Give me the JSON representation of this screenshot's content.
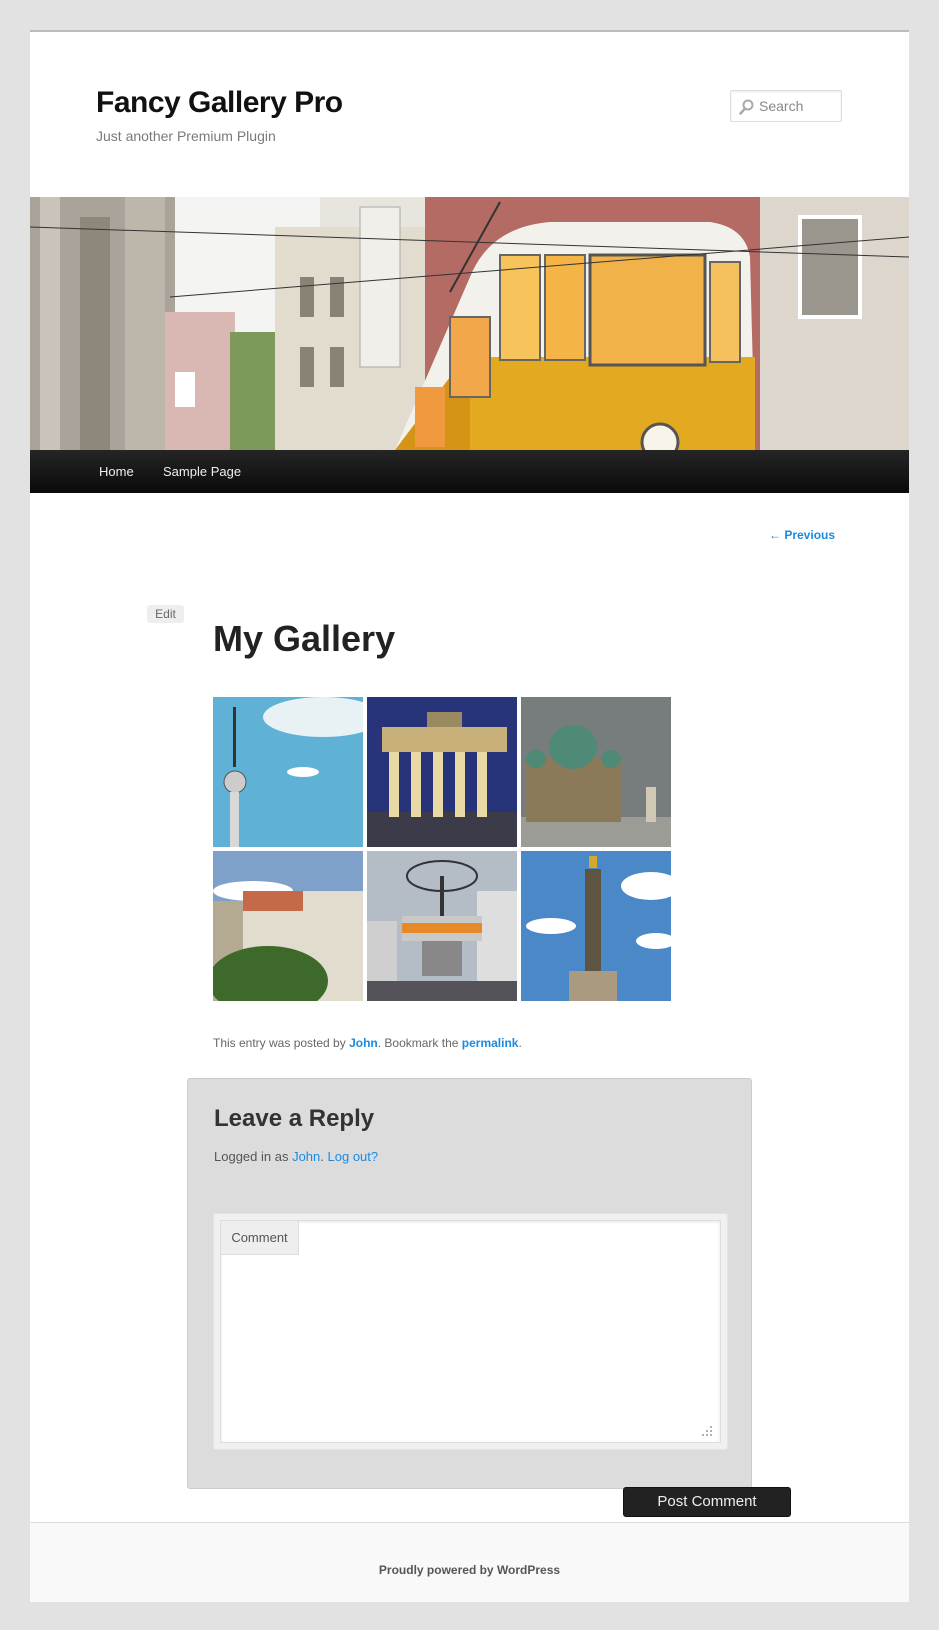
{
  "site": {
    "title": "Fancy Gallery Pro",
    "description": "Just another Premium Plugin"
  },
  "search": {
    "placeholder": "Search"
  },
  "nav": {
    "items": [
      {
        "label": "Home"
      },
      {
        "label": "Sample Page"
      }
    ]
  },
  "post_nav": {
    "previous": "← Previous"
  },
  "entry": {
    "edit_label": "Edit",
    "title": "My Gallery",
    "meta_prefix": "This entry was posted by ",
    "author": "John",
    "meta_mid": ". Bookmark the ",
    "permalink": "permalink",
    "meta_suffix": "."
  },
  "gallery": {
    "images": [
      {
        "subject": "TV tower"
      },
      {
        "subject": "Brandenburg Gate at night"
      },
      {
        "subject": "Berlin Cathedral"
      },
      {
        "subject": "City buildings"
      },
      {
        "subject": "World clock"
      },
      {
        "subject": "Victory column"
      }
    ]
  },
  "reply": {
    "title": "Leave a Reply",
    "logged_in_prefix": "Logged in as ",
    "user": "John",
    "logged_in_mid": ". ",
    "logout": "Log out?",
    "comment_label": "Comment",
    "submit_label": "Post Comment"
  },
  "footer": {
    "text": "Proudly powered by WordPress"
  },
  "colors": {
    "link": "#1b8be0",
    "nav_bg": "#1a1a1a",
    "page_bg": "#e2e2e2"
  }
}
